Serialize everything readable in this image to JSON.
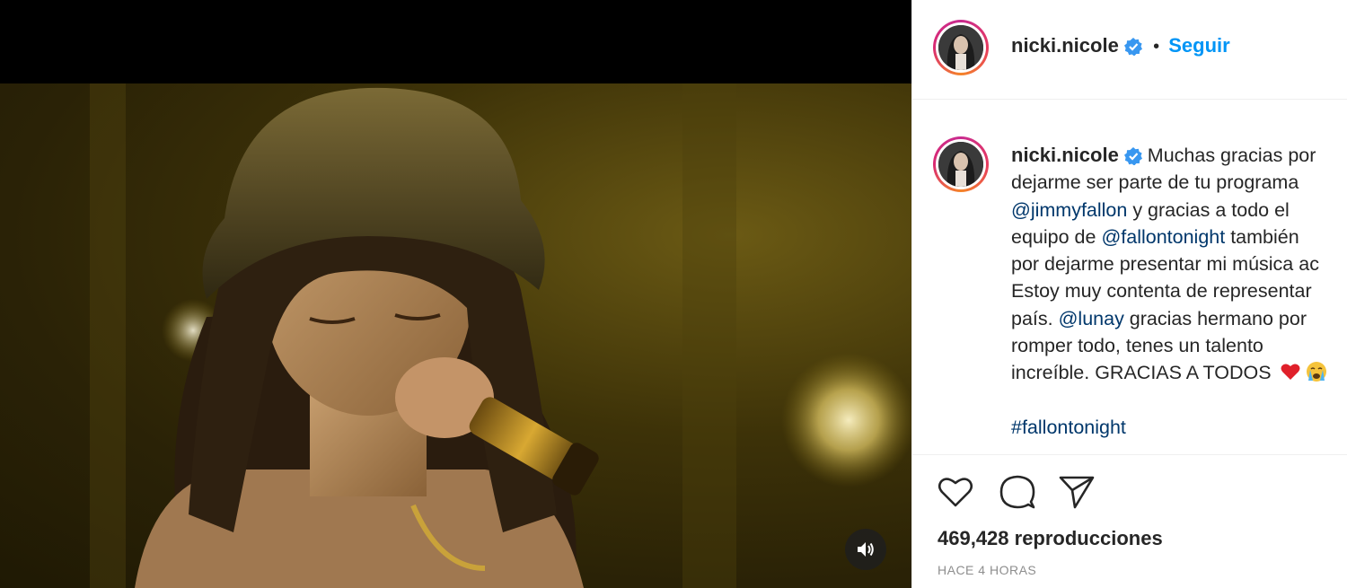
{
  "post": {
    "username": "nicki.nicole",
    "separator": "•",
    "follow_label": "Seguir",
    "caption": {
      "line1_text": "Muchas gracias por",
      "line2_text": "dejarme ser parte de tu programa",
      "line3_mention": "@jimmyfallon",
      "line3_text": " y gracias a todo el",
      "line4_prefix": "equipo de ",
      "line4_mention": "@fallontonight",
      "line4_text": " también",
      "line5_text": "por dejarme presentar mi música ac",
      "line6_text": "Estoy muy contenta de representar",
      "line7_prefix": "país. ",
      "line7_mention": "@lunay",
      "line7_text": " gracias hermano por",
      "line8_text": "romper todo, tenes un talento",
      "line9_text": "increíble. GRACIAS A TODOS",
      "hashtag": "#fallontonight"
    },
    "views": "469,428 reproducciones",
    "timestamp": "HACE 4 HORAS"
  },
  "icons": {
    "like": "heart-icon",
    "comment": "comment-icon",
    "share": "send-icon",
    "verified": "verified-badge-icon",
    "mute": "volume-icon",
    "emojis": [
      "red-heart-emoji",
      "crying-face-emoji"
    ]
  },
  "colors": {
    "link": "#00376b",
    "follow": "#0095f6",
    "verified": "#3897f0",
    "muted_text": "#8e8e8e"
  }
}
